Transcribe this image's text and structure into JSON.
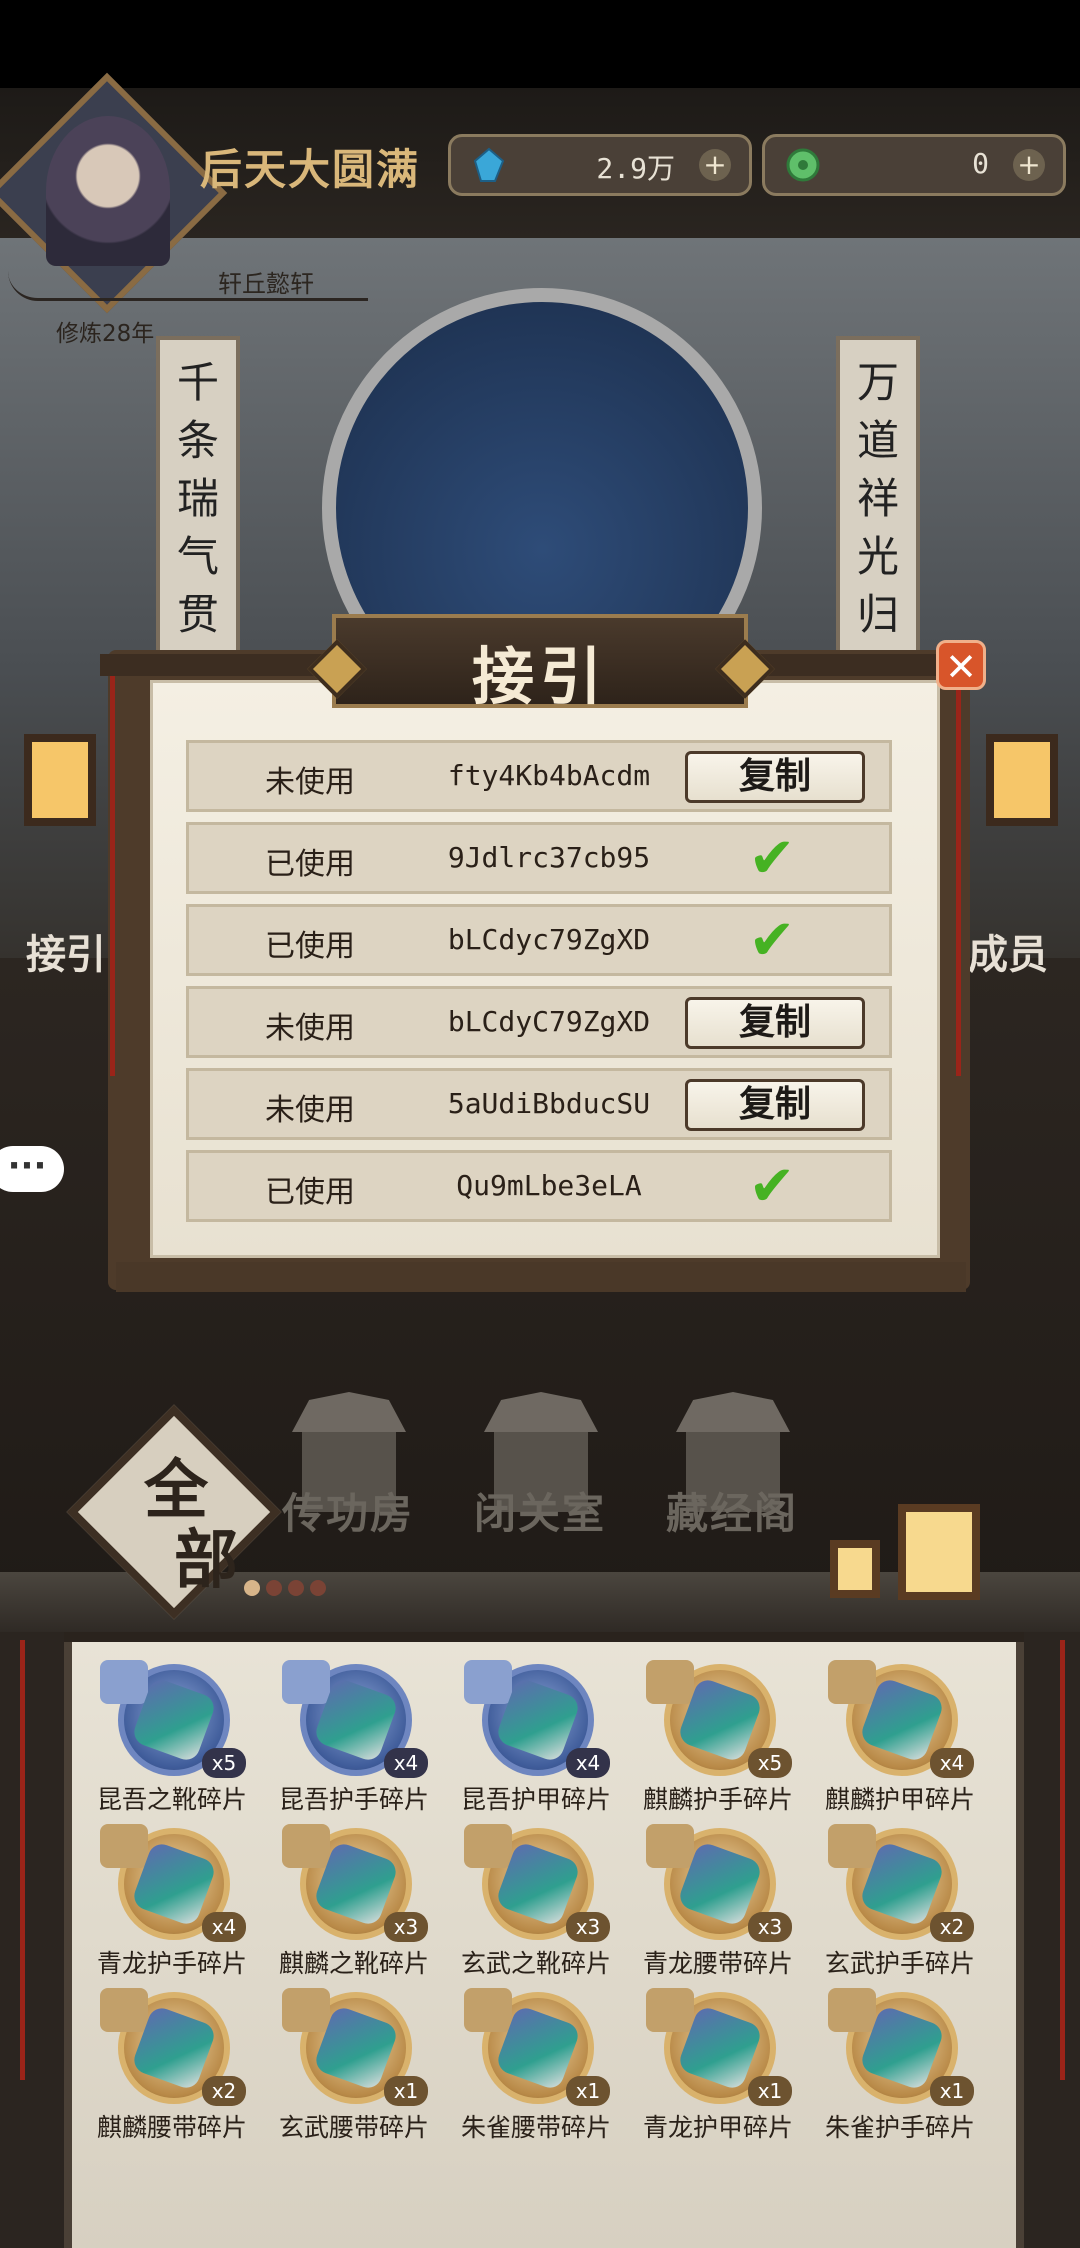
{
  "player": {
    "title": "后天大圆满",
    "name": "轩丘懿轩",
    "cultivation": "修炼28年"
  },
  "resources": [
    {
      "icon": "blue-crystal-icon",
      "value": "2.9万"
    },
    {
      "icon": "jade-coin-icon",
      "value": "0"
    }
  ],
  "couplets": {
    "left": "千条瑞气贯昔",
    "right": "万道祥光归此"
  },
  "side": {
    "left_label": "接引",
    "right_label": "成员"
  },
  "dialog": {
    "title": "接引",
    "copy_label": "复制",
    "rows": [
      {
        "status": "未使用",
        "code": "fty4Kb4bAcdm",
        "action": "copy"
      },
      {
        "status": "已使用",
        "code": "9Jdlrc37cb95",
        "action": "check"
      },
      {
        "status": "已使用",
        "code": "bLCdyc79ZgXD",
        "action": "check"
      },
      {
        "status": "未使用",
        "code": "bLCdyC79ZgXD",
        "action": "copy"
      },
      {
        "status": "未使用",
        "code": "5aUdiBbducSU",
        "action": "copy"
      },
      {
        "status": "已使用",
        "code": "Qu9mLbe3eLA",
        "action": "check"
      }
    ]
  },
  "buildings": [
    "传功房",
    "闭关室",
    "藏经阁"
  ],
  "filter": {
    "label_top": "全",
    "label_bottom": "部"
  },
  "pager": {
    "total": 4,
    "current": 1
  },
  "items": [
    {
      "name": "昆吾之靴碎片",
      "qty": "x5",
      "tier": "blue"
    },
    {
      "name": "昆吾护手碎片",
      "qty": "x4",
      "tier": "blue"
    },
    {
      "name": "昆吾护甲碎片",
      "qty": "x4",
      "tier": "blue"
    },
    {
      "name": "麒麟护手碎片",
      "qty": "x5",
      "tier": "gold"
    },
    {
      "name": "麒麟护甲碎片",
      "qty": "x4",
      "tier": "gold"
    },
    {
      "name": "青龙护手碎片",
      "qty": "x4",
      "tier": "gold"
    },
    {
      "name": "麒麟之靴碎片",
      "qty": "x3",
      "tier": "gold"
    },
    {
      "name": "玄武之靴碎片",
      "qty": "x3",
      "tier": "gold"
    },
    {
      "name": "青龙腰带碎片",
      "qty": "x3",
      "tier": "gold"
    },
    {
      "name": "玄武护手碎片",
      "qty": "x2",
      "tier": "gold"
    },
    {
      "name": "麒麟腰带碎片",
      "qty": "x2",
      "tier": "gold"
    },
    {
      "name": "玄武腰带碎片",
      "qty": "x1",
      "tier": "gold"
    },
    {
      "name": "朱雀腰带碎片",
      "qty": "x1",
      "tier": "gold"
    },
    {
      "name": "青龙护甲碎片",
      "qty": "x1",
      "tier": "gold"
    },
    {
      "name": "朱雀护手碎片",
      "qty": "x1",
      "tier": "gold"
    }
  ]
}
